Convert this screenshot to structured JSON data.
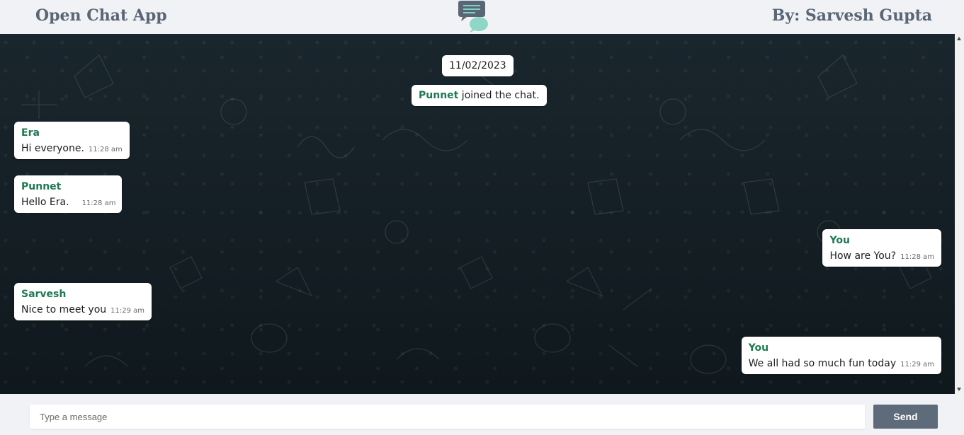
{
  "header": {
    "title": "Open Chat App",
    "author": "By: Sarvesh Gupta",
    "logo_icon": "chat-bubbles-icon"
  },
  "chat": {
    "date": "11/02/2023",
    "join_notice": {
      "name": "Punnet",
      "text": " joined the chat."
    },
    "messages": [
      {
        "sender": "Era",
        "text": "Hi everyone.",
        "time": "11:28 am",
        "side": "left"
      },
      {
        "sender": "Punnet",
        "text": "Hello Era.",
        "time": "11:28 am",
        "side": "left"
      },
      {
        "sender": "You",
        "text": "How are You?",
        "time": "11:28 am",
        "side": "right"
      },
      {
        "sender": "Sarvesh",
        "text": "Nice to meet you",
        "time": "11:29 am",
        "side": "left"
      },
      {
        "sender": "You",
        "text": "We all had so much fun today",
        "time": "11:29 am",
        "side": "right"
      }
    ]
  },
  "composer": {
    "placeholder": "Type a message",
    "send_label": "Send"
  },
  "colors": {
    "sender_name": "#1f7a52",
    "chat_background": "#111b21",
    "send_button": "#5d6b7b",
    "header_text": "#5a6675"
  }
}
